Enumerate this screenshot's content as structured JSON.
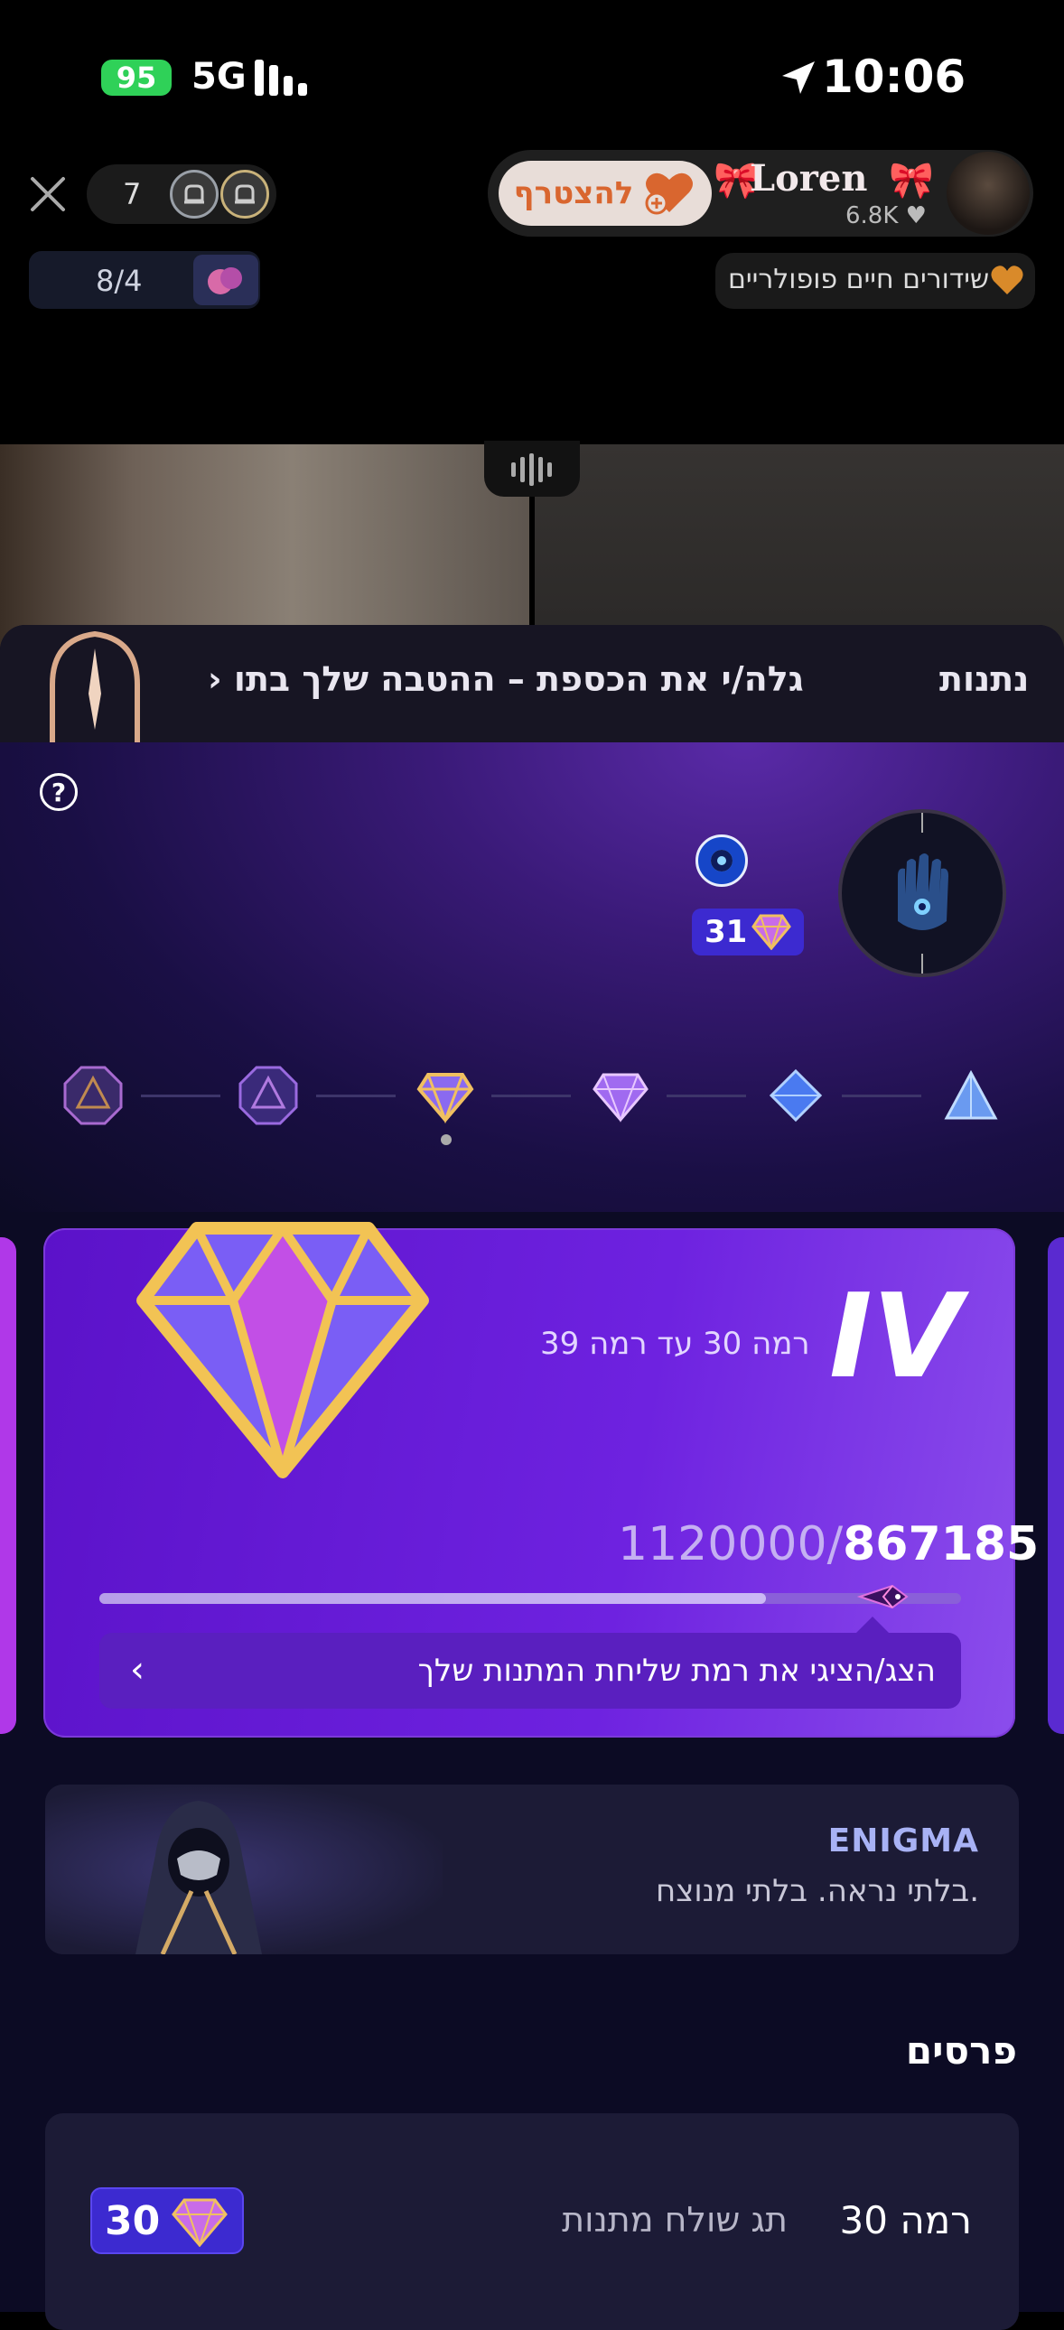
{
  "status_bar": {
    "battery": "95",
    "network": "5G",
    "time": "10:06"
  },
  "live_header": {
    "viewer_count": "7",
    "join_label": "להצטרף",
    "host_name": "Loren",
    "host_likes": "6.8K",
    "pk_progress": "8/4",
    "popular_label": "שידורים חיים פופולריים"
  },
  "banner": {
    "text": "גלה/י את הכספת – ההטבה שלך בתו",
    "chevron": "›",
    "side_text": "נתנות"
  },
  "hero": {
    "help": "?",
    "gem_count": "31"
  },
  "level_card": {
    "roman": "IV",
    "range": "רמה 30 עד רמה 39",
    "current": "867185",
    "max": "1120000/",
    "progress_fraction": 0.774,
    "tooltip": "הצג/הציגי את רמת שליחת המתנות שלך",
    "chevron": "‹"
  },
  "enigma": {
    "title": "ENIGMA",
    "subtitle": "בלתי נראה. בלתי מנוצח."
  },
  "rewards": {
    "heading": "פרסים",
    "item_level": "רמה 30",
    "item_label": "תג שולח מתנות",
    "badge_value": "30"
  },
  "colors": {
    "accent": "#6e22e0",
    "badge": "#3c2ad0",
    "gold": "#e8b84a",
    "join": "#d9662f"
  }
}
